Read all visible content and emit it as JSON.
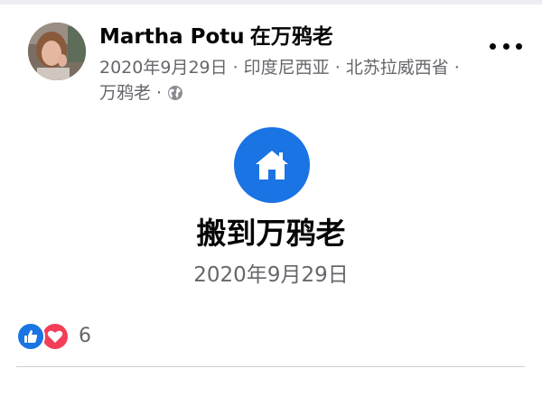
{
  "post": {
    "author": "Martha Potu",
    "at_word": "在",
    "place": "万鸦老",
    "date": "2020年9月29日",
    "location_country": "印度尼西亚",
    "location_region": "北苏拉威西省",
    "location_city": "万鸦老",
    "separator": "·",
    "privacy_icon": "globe-icon",
    "more_icon": "more-options-icon"
  },
  "life_event": {
    "icon": "home-icon",
    "icon_color": "#1b74e4",
    "title": "搬到万鸦老",
    "date": "2020年9月29日"
  },
  "reactions": {
    "icons": [
      "like-icon",
      "love-icon"
    ],
    "like_color": "#1b74e4",
    "love_color": "#f33e58",
    "count": "6"
  }
}
